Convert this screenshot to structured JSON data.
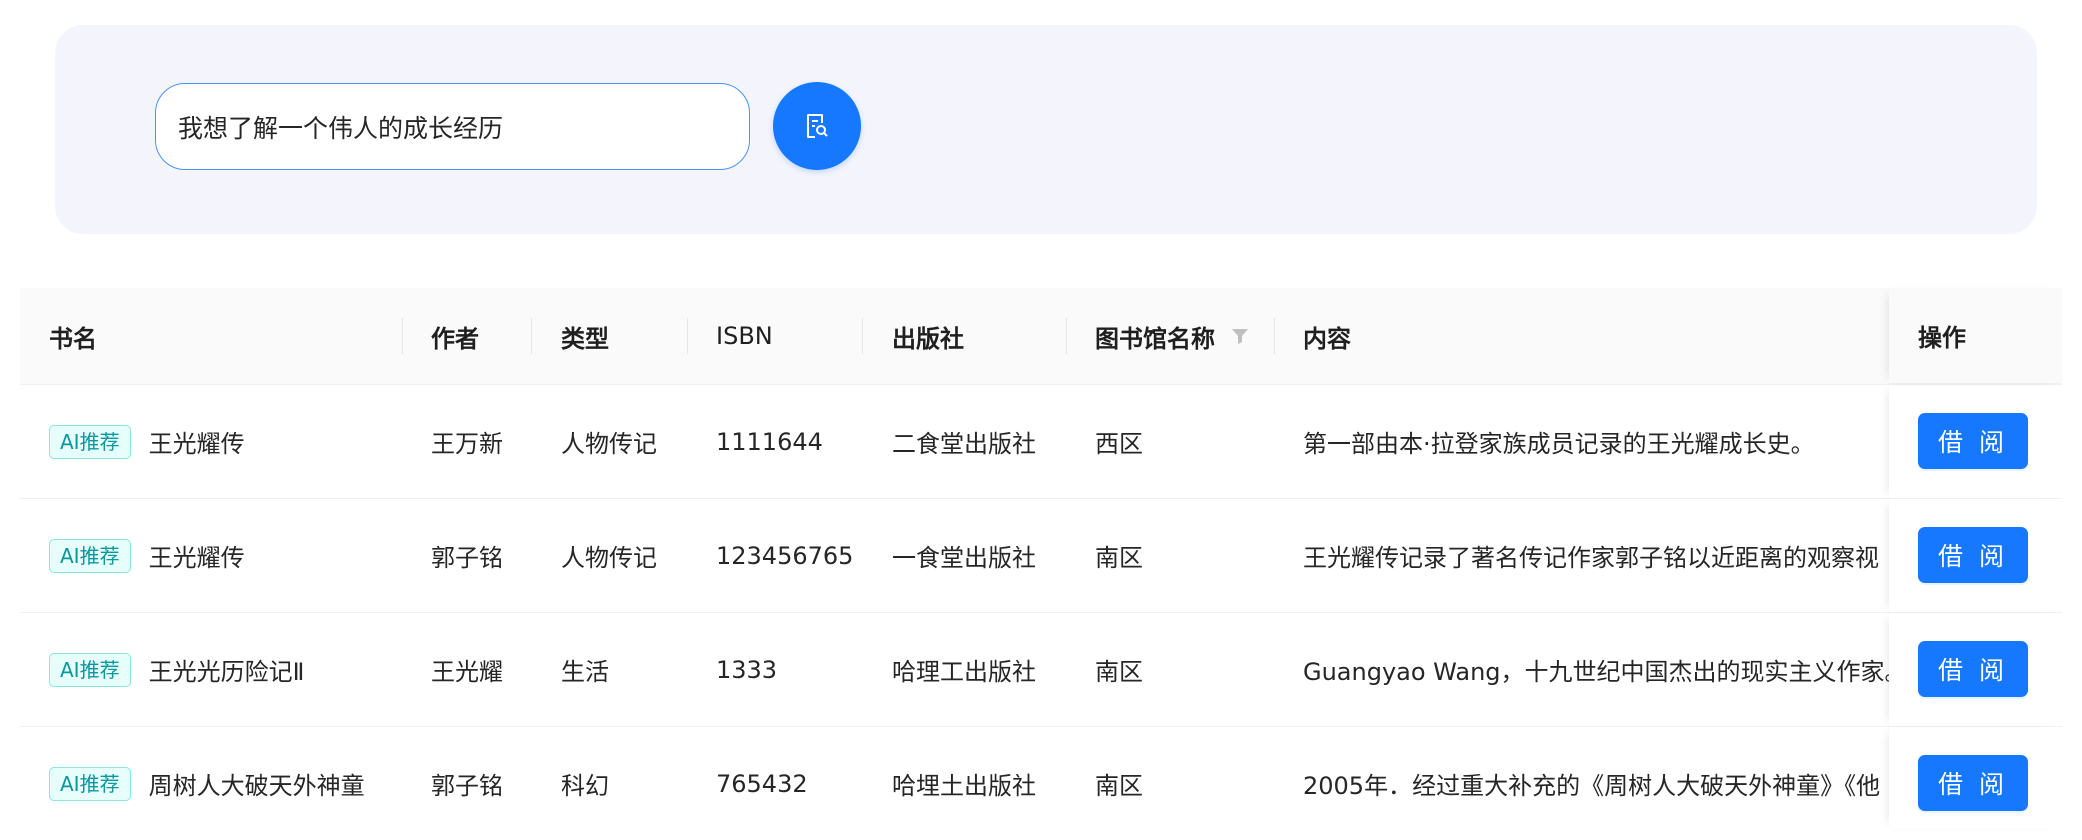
{
  "search": {
    "value": "我想了解一个伟人的成长经历"
  },
  "table": {
    "headers": {
      "title": "书名",
      "author": "作者",
      "type": "类型",
      "isbn": "ISBN",
      "publisher": "出版社",
      "library": "图书馆名称",
      "content": "内容",
      "action": "操作"
    },
    "rows": [
      {
        "tag": "AI推荐",
        "title": "王光耀传",
        "author": "王万新",
        "type": "人物传记",
        "isbn": "1111644",
        "publisher": "二食堂出版社",
        "library": "西区",
        "content": "第一部由本·拉登家族成员记录的王光耀成长史。",
        "action": "借 阅"
      },
      {
        "tag": "AI推荐",
        "title": "王光耀传",
        "author": "郭子铭",
        "type": "人物传记",
        "isbn": "123456765",
        "publisher": "一食堂出版社",
        "library": "南区",
        "content": "王光耀传记录了著名传记作家郭子铭以近距离的观察视",
        "action": "借 阅"
      },
      {
        "tag": "AI推荐",
        "title": "王光光历险记Ⅱ",
        "author": "王光耀",
        "type": "生活",
        "isbn": "1333",
        "publisher": "哈理工出版社",
        "library": "南区",
        "content": "Guangyao Wang，十九世纪中国杰出的现实主义作家。",
        "action": "借 阅"
      },
      {
        "tag": "AI推荐",
        "title": "周树人大破天外神童",
        "author": "郭子铭",
        "type": "科幻",
        "isbn": "765432",
        "publisher": "哈埋土出版社",
        "library": "南区",
        "content": "2005年．经过重大补充的《周树人大破天外神童》《他",
        "action": "借 阅"
      }
    ]
  },
  "colors": {
    "primary": "#1677ff",
    "panel_bg": "#f4f5fc",
    "tag_text": "#08979c",
    "tag_bg": "#e6fffb",
    "tag_border": "#87e8de"
  },
  "icons": {
    "search_button": "document-search-icon",
    "library_filter": "filter-icon"
  }
}
